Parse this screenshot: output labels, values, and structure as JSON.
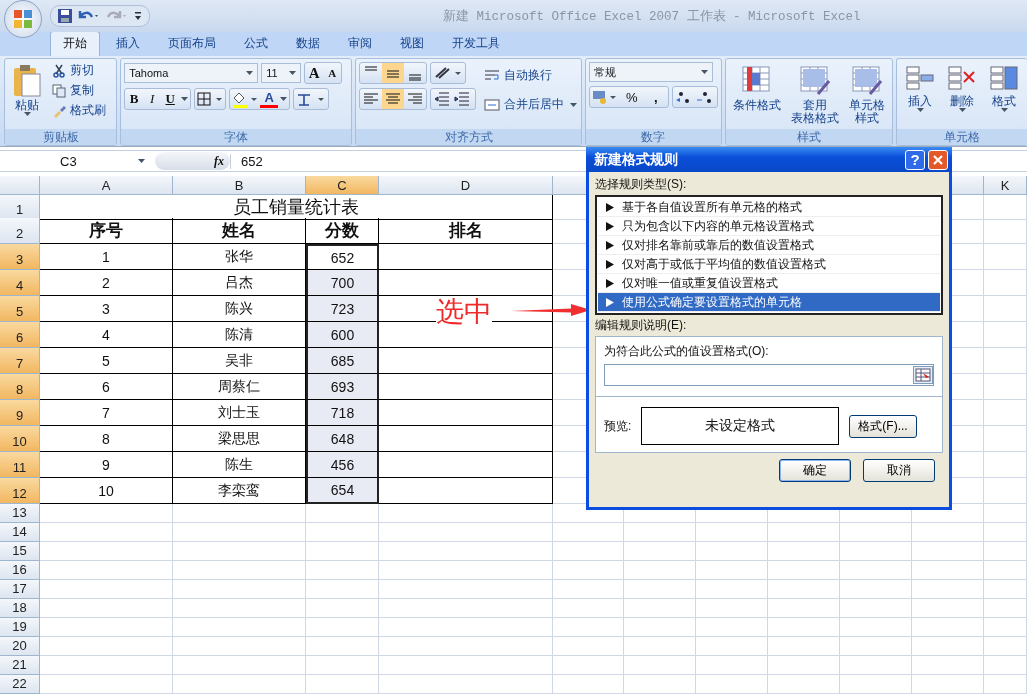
{
  "window": {
    "title": "新建 Microsoft Office Excel 2007 工作表 - Microsoft Excel"
  },
  "tabs": [
    {
      "label": "开始",
      "selected": true
    },
    {
      "label": "插入",
      "selected": false
    },
    {
      "label": "页面布局",
      "selected": false
    },
    {
      "label": "公式",
      "selected": false
    },
    {
      "label": "数据",
      "selected": false
    },
    {
      "label": "审阅",
      "selected": false
    },
    {
      "label": "视图",
      "selected": false
    },
    {
      "label": "开发工具",
      "selected": false
    }
  ],
  "ribbon": {
    "clipboard": {
      "title": "剪贴板",
      "paste": "粘贴",
      "cut": "剪切",
      "copy": "复制",
      "format_painter": "格式刷"
    },
    "font": {
      "title": "字体",
      "font_name": "Tahoma",
      "font_size": "11",
      "grow": "A",
      "shrink": "A",
      "bold": "B",
      "italic": "I",
      "underline": "U",
      "font_color": "A"
    },
    "alignment": {
      "title": "对齐方式",
      "wrap": "自动换行",
      "merge": "合并后居中",
      "vertical": [
        {
          "selected": false
        },
        {
          "selected": true
        },
        {
          "selected": false
        }
      ],
      "horizontal": [
        {
          "selected": false
        },
        {
          "selected": true
        },
        {
          "selected": false
        }
      ]
    },
    "number": {
      "title": "数字",
      "format": "常规",
      "percent": "%",
      "comma": ","
    },
    "styles": {
      "title": "样式",
      "buttons": [
        {
          "lines": [
            "条件格式"
          ]
        },
        {
          "lines": [
            "套用",
            "表格格式"
          ]
        },
        {
          "lines": [
            "单元格",
            "样式"
          ]
        }
      ]
    },
    "cells": {
      "title": "单元格",
      "buttons": [
        "插入",
        "删除",
        "格式"
      ]
    }
  },
  "formula_bar": {
    "name_box": "C3",
    "fx": "fx",
    "value": "652"
  },
  "sheet": {
    "columns": [
      {
        "label": "A",
        "selected": false
      },
      {
        "label": "B",
        "selected": false
      },
      {
        "label": "C",
        "selected": true
      },
      {
        "label": "D",
        "selected": false
      },
      {
        "label": "K",
        "selected": false
      }
    ],
    "title_row": {
      "number": "1",
      "title": "员工销量统计表"
    },
    "header_row": {
      "number": "2",
      "cells": [
        "序号",
        "姓名",
        "分数",
        "排名"
      ]
    },
    "rows": [
      {
        "number": "3",
        "selected": true,
        "active": true,
        "cells": [
          "1",
          "张华",
          "652"
        ]
      },
      {
        "number": "4",
        "selected": true,
        "active": false,
        "cells": [
          "2",
          "吕杰",
          "700"
        ]
      },
      {
        "number": "5",
        "selected": true,
        "active": false,
        "cells": [
          "3",
          "陈兴",
          "723"
        ]
      },
      {
        "number": "6",
        "selected": true,
        "active": false,
        "cells": [
          "4",
          "陈清",
          "600"
        ]
      },
      {
        "number": "7",
        "selected": true,
        "active": false,
        "cells": [
          "5",
          "吴非",
          "685"
        ]
      },
      {
        "number": "8",
        "selected": true,
        "active": false,
        "cells": [
          "6",
          "周蔡仁",
          "693"
        ]
      },
      {
        "number": "9",
        "selected": true,
        "active": false,
        "cells": [
          "7",
          "刘士玉",
          "718"
        ]
      },
      {
        "number": "10",
        "selected": true,
        "active": false,
        "cells": [
          "8",
          "梁思思",
          "648"
        ]
      },
      {
        "number": "11",
        "selected": true,
        "active": false,
        "cells": [
          "9",
          "陈生",
          "456"
        ]
      },
      {
        "number": "12",
        "selected": true,
        "active": false,
        "cells": [
          "10",
          "李栾鸾",
          "654"
        ]
      }
    ],
    "empty_rows": [
      {
        "number": "13",
        "selected": false
      },
      {
        "number": "14",
        "selected": false
      },
      {
        "number": "15",
        "selected": false
      },
      {
        "number": "16",
        "selected": false
      },
      {
        "number": "17",
        "selected": false
      },
      {
        "number": "18",
        "selected": false
      },
      {
        "number": "19",
        "selected": false
      },
      {
        "number": "20",
        "selected": false
      },
      {
        "number": "21",
        "selected": false
      },
      {
        "number": "22",
        "selected": false
      }
    ]
  },
  "annotation": {
    "text": "选中"
  },
  "dialog": {
    "title": "新建格式规则",
    "help": "?",
    "rule_type_label": "选择规则类型(S):",
    "rule_types": [
      {
        "label": "基于各自值设置所有单元格的格式",
        "selected": false
      },
      {
        "label": "只为包含以下内容的单元格设置格式",
        "selected": false
      },
      {
        "label": "仅对排名靠前或靠后的数值设置格式",
        "selected": false
      },
      {
        "label": "仅对高于或低于平均值的数值设置格式",
        "selected": false
      },
      {
        "label": "仅对唯一值或重复值设置格式",
        "selected": false
      },
      {
        "label": "使用公式确定要设置格式的单元格",
        "selected": true
      }
    ],
    "edit_label": "编辑规则说明(E):",
    "formula_label": "为符合此公式的值设置格式(O):",
    "preview_label": "预览:",
    "preview_text": "未设定格式",
    "format_button": "格式(F)...",
    "ok": "确定",
    "cancel": "取消"
  }
}
